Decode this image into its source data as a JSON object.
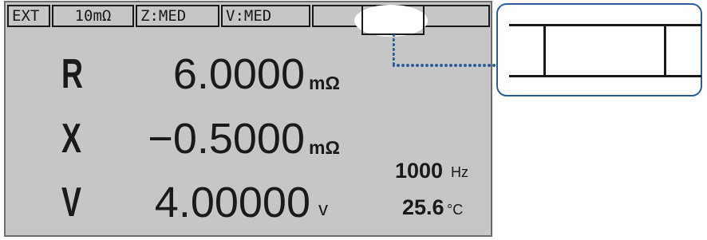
{
  "status_bar": {
    "trigger": "EXT",
    "range": "10mΩ",
    "z_speed": "Z:MED",
    "v_speed": "V:MED",
    "blank": ""
  },
  "readings": {
    "r": {
      "letter": "R",
      "value": "6.0000",
      "unit": "mΩ"
    },
    "x": {
      "letter": "X",
      "value": "−0.5000",
      "unit": "mΩ"
    },
    "v": {
      "letter": "V",
      "value": "4.00000",
      "unit": "v"
    }
  },
  "frequency": {
    "value": "1000",
    "unit": "Hz"
  },
  "temperature": {
    "value": "25.6",
    "unit": "°C"
  },
  "colors": {
    "lcd_background": "#c6c6c6",
    "lcd_text": "#1a1a1a",
    "callout_border": "#2c5d99",
    "leader_dots": "#2c5d99"
  }
}
